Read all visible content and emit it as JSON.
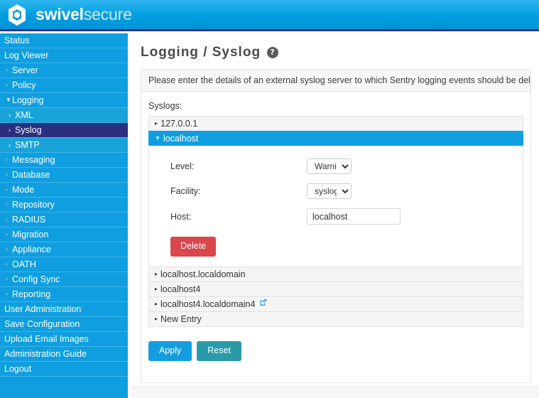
{
  "brand": {
    "name_bold": "swivel",
    "name_light": "secure",
    "logo_icon": "swivel-hexagon-logo"
  },
  "sidebar": {
    "items": [
      {
        "label": "Status",
        "level": 1,
        "caret": "",
        "active": false
      },
      {
        "label": "Log Viewer",
        "level": 1,
        "caret": "",
        "active": false
      },
      {
        "label": "Server",
        "level": 2,
        "caret": "right",
        "active": false
      },
      {
        "label": "Policy",
        "level": 2,
        "caret": "right",
        "active": false
      },
      {
        "label": "Logging",
        "level": 2,
        "caret": "down",
        "active": false
      },
      {
        "label": "XML",
        "level": 3,
        "caret": "sub",
        "active": false
      },
      {
        "label": "Syslog",
        "level": 3,
        "caret": "sub",
        "active": true
      },
      {
        "label": "SMTP",
        "level": 3,
        "caret": "sub",
        "active": false
      },
      {
        "label": "Messaging",
        "level": 2,
        "caret": "right",
        "active": false
      },
      {
        "label": "Database",
        "level": 2,
        "caret": "right",
        "active": false
      },
      {
        "label": "Mode",
        "level": 2,
        "caret": "right",
        "active": false
      },
      {
        "label": "Repository",
        "level": 2,
        "caret": "right",
        "active": false
      },
      {
        "label": "RADIUS",
        "level": 2,
        "caret": "right",
        "active": false
      },
      {
        "label": "Migration",
        "level": 2,
        "caret": "right",
        "active": false
      },
      {
        "label": "Appliance",
        "level": 2,
        "caret": "right",
        "active": false
      },
      {
        "label": "OATH",
        "level": 2,
        "caret": "right",
        "active": false
      },
      {
        "label": "Config Sync",
        "level": 2,
        "caret": "right",
        "active": false
      },
      {
        "label": "Reporting",
        "level": 2,
        "caret": "right",
        "active": false
      },
      {
        "label": "User Administration",
        "level": 1,
        "caret": "",
        "active": false
      },
      {
        "label": "Save Configuration",
        "level": 1,
        "caret": "",
        "active": false
      },
      {
        "label": "Upload Email Images",
        "level": 1,
        "caret": "",
        "active": false
      },
      {
        "label": "Administration Guide",
        "level": 1,
        "caret": "",
        "active": false
      },
      {
        "label": "Logout",
        "level": 1,
        "caret": "",
        "active": false
      }
    ]
  },
  "main": {
    "title": "Logging / Syslog",
    "help_icon": "question-mark-help-icon",
    "note": "Please enter the details of an external syslog server to which Sentry logging events should be delivered.",
    "syslogs_label": "Syslogs:",
    "entries": [
      {
        "label": "127.0.0.1",
        "open": false,
        "has_edit_badge": false
      },
      {
        "label": "localhost",
        "open": true,
        "has_edit_badge": false
      },
      {
        "label": "localhost.localdomain",
        "open": false,
        "has_edit_badge": false
      },
      {
        "label": "localhost4",
        "open": false,
        "has_edit_badge": false
      },
      {
        "label": "localhost4.localdomain4",
        "open": false,
        "has_edit_badge": true
      },
      {
        "label": "New Entry",
        "open": false,
        "has_edit_badge": false
      }
    ],
    "form": {
      "level_label": "Level:",
      "level_value": "Warning",
      "level_options": [
        "Warning"
      ],
      "facility_label": "Facility:",
      "facility_value": "syslog",
      "facility_options": [
        "syslog"
      ],
      "host_label": "Host:",
      "host_value": "localhost",
      "host_placeholder": "",
      "delete_label": "Delete"
    },
    "apply_label": "Apply",
    "reset_label": "Reset"
  },
  "colors": {
    "brand_blue": "#0f9ee0",
    "navy_border": "#2b2f80",
    "active_nav": "#2b2f80",
    "delete_red": "#d9464c",
    "apply_blue": "#139ee2",
    "reset_teal": "#2a9aa8",
    "edit_icon_blue": "#2196f3"
  }
}
